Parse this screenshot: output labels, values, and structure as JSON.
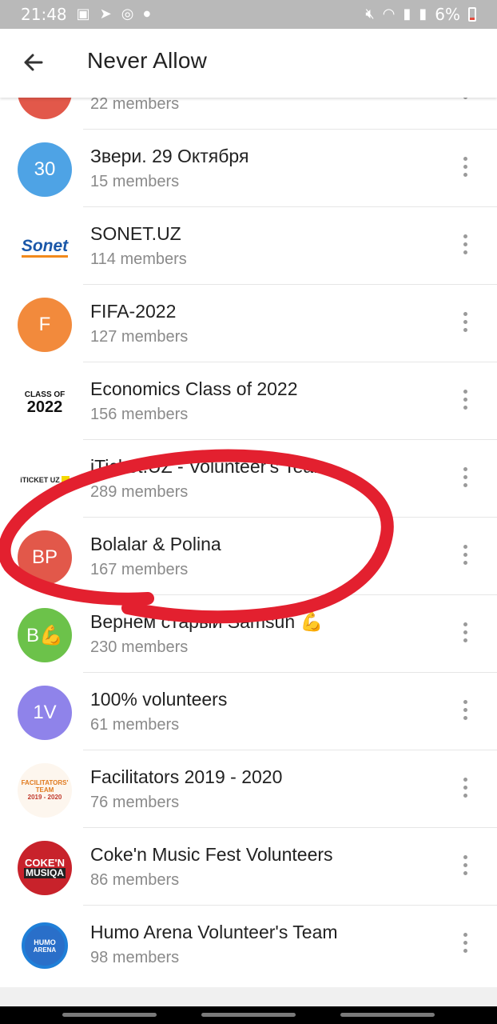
{
  "status_bar": {
    "time": "21:48",
    "battery": "6%"
  },
  "header": {
    "title": "Never Allow"
  },
  "groups": [
    {
      "name": "",
      "members": "22 members",
      "avatar_text": "",
      "avatar_color": "#e2584a"
    },
    {
      "name": "Звери. 29 Октября",
      "members": "15 members",
      "avatar_text": "30",
      "avatar_color": "#4ea3e5"
    },
    {
      "name": "SONET.UZ",
      "members": "114 members",
      "avatar_text": "",
      "avatar_color": "#ffffff",
      "logo_text": "Sonet"
    },
    {
      "name": "FIFA-2022",
      "members": "127 members",
      "avatar_text": "F",
      "avatar_color": "#f28a3c"
    },
    {
      "name": "Economics Class of 2022",
      "members": "156 members",
      "avatar_text": "",
      "avatar_color": "#ffffff",
      "logo_line1": "CLASS OF",
      "logo_line2": "2022"
    },
    {
      "name": "iTicket.UZ - Volunteer's Team",
      "members": "289 members",
      "avatar_text": "",
      "avatar_color": "#ffffff",
      "logo_text": "iTICKET UZ"
    },
    {
      "name": "Bolalar & Polina",
      "members": "167 members",
      "avatar_text": "BP",
      "avatar_color": "#e2584a"
    },
    {
      "name": "Вернем старый Samsun 💪",
      "members": "230 members",
      "avatar_text": "B💪",
      "avatar_color": "#6cc24a"
    },
    {
      "name": "100% volunteers",
      "members": "61 members",
      "avatar_text": "1V",
      "avatar_color": "#8f83ea"
    },
    {
      "name": "Facilitators 2019 - 2020",
      "members": "76 members",
      "avatar_text": "",
      "avatar_color": "#ffffff",
      "logo_line1": "FACILITATORS' TEAM",
      "logo_line2": "2019 - 2020"
    },
    {
      "name": "Coke'n Music Fest Volunteers",
      "members": "86 members",
      "avatar_text": "",
      "avatar_color": "#c8222b",
      "logo_line1": "COKE'N",
      "logo_line2": "MUSIQA"
    },
    {
      "name": "Humo Arena Volunteer's Team",
      "members": "98 members",
      "avatar_text": "",
      "avatar_color": "#ffffff",
      "logo_line1": "HUMO",
      "logo_line2": "ARENA"
    }
  ],
  "colors": {
    "annotation": "#e3202f",
    "accent": "#4ea3e5"
  }
}
